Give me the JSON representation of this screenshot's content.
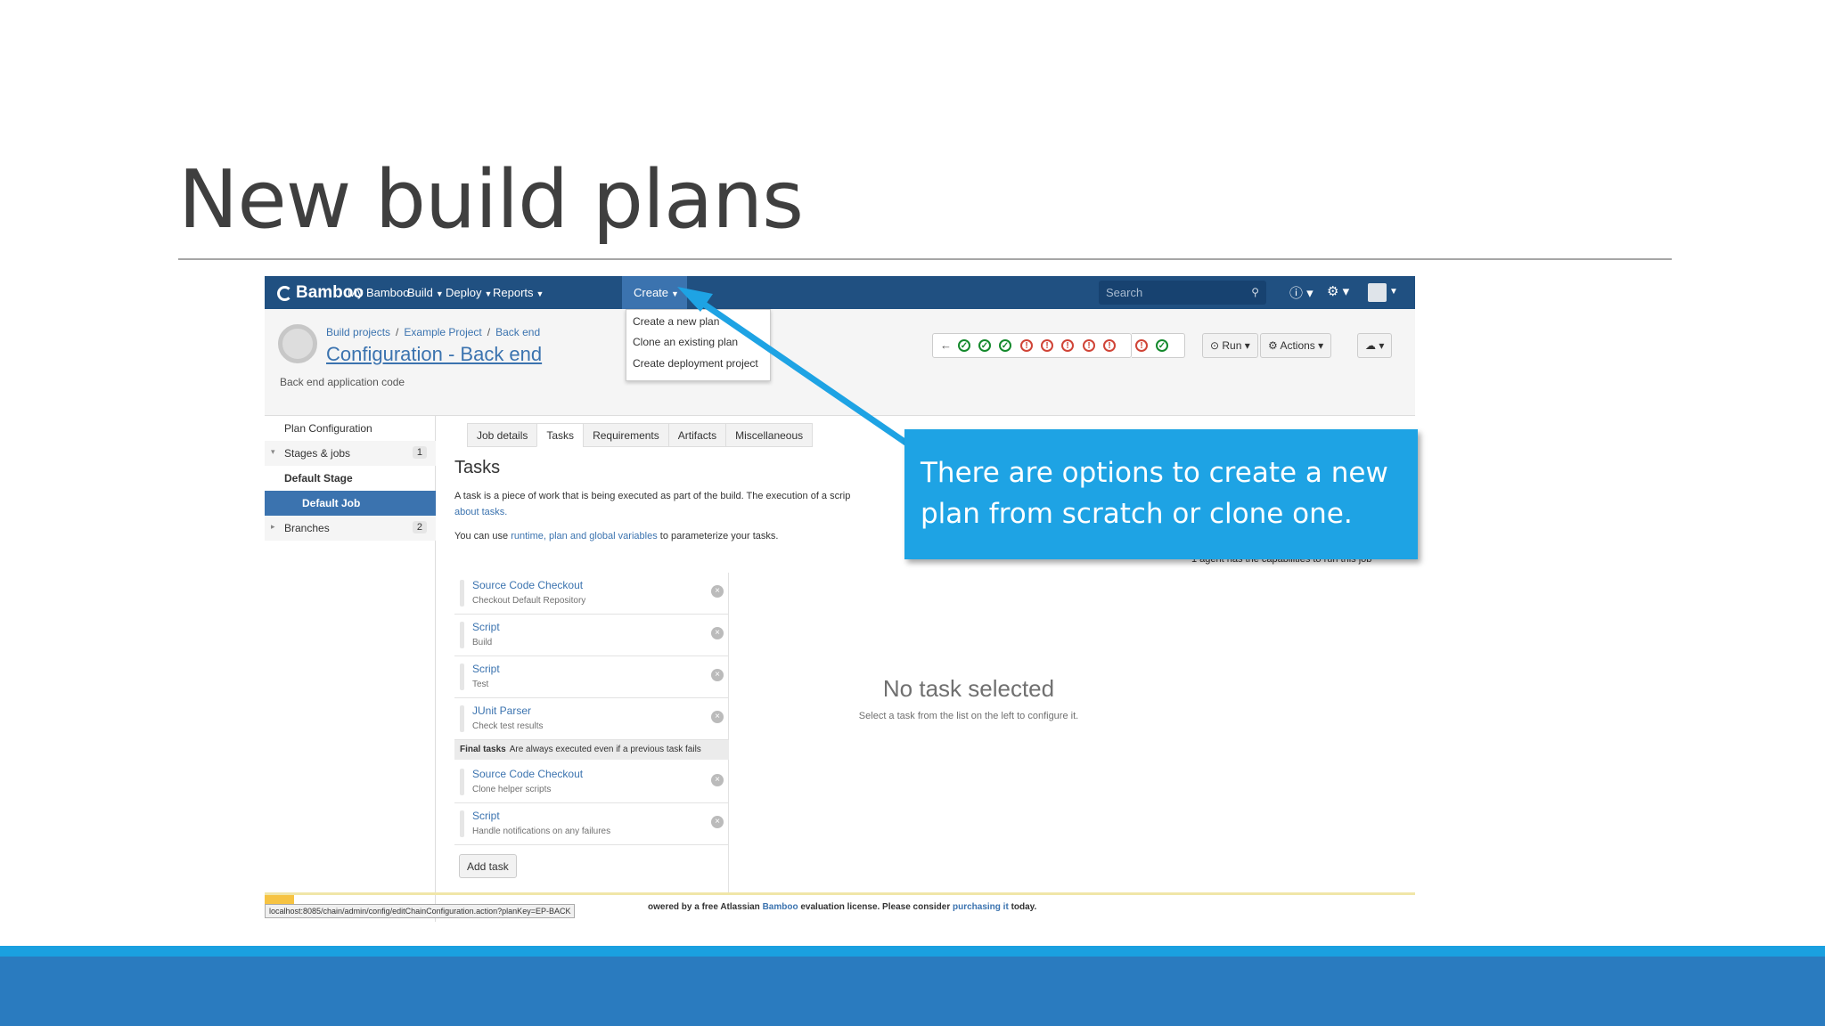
{
  "slide": {
    "title": "New build plans",
    "callout": "There are options to create a new plan from scratch or clone one."
  },
  "colors": {
    "bamboo_header": "#205081",
    "link": "#3b73af",
    "callout": "#1ea3e4",
    "band": "#2a7bbf"
  },
  "app": {
    "logo": "Bamboo",
    "nav": [
      "My Bamboo",
      "Build",
      "Deploy",
      "Reports",
      "Create"
    ],
    "search_placeholder": "Search",
    "create_menu": [
      "Create a new plan",
      "Clone an existing plan",
      "Create deployment project"
    ]
  },
  "plan": {
    "breadcrumbs": [
      "Build projects",
      "Example Project",
      "Back end"
    ],
    "title": "Configuration - Back end",
    "description": "Back end application code",
    "status_icons": [
      "pass",
      "pass",
      "pass",
      "fail",
      "fail",
      "fail",
      "fail",
      "fail",
      "fail",
      "pass"
    ],
    "run_label": "Run",
    "actions_label": "Actions"
  },
  "sidebar": {
    "items": [
      {
        "label": "Plan Configuration"
      },
      {
        "label": "Stages & jobs",
        "count": "1"
      },
      {
        "label": "Default Stage"
      },
      {
        "label": "Default Job"
      },
      {
        "label": "Branches",
        "count": "2"
      }
    ]
  },
  "tabs": [
    "Job details",
    "Tasks",
    "Requirements",
    "Artifacts",
    "Miscellaneous"
  ],
  "tasks_panel": {
    "heading": "Tasks",
    "desc_line1": "A task is a piece of work that is being executed as part of the build. The execution of a scrip",
    "desc_line1_link": "about tasks.",
    "desc_line2_pre": "You can use ",
    "desc_line2_link": "runtime, plan and global variables",
    "desc_line2_post": " to parameterize your tasks.",
    "agents_note": "1 agent has the capabilities to run this job",
    "tasks": [
      {
        "name": "Source Code Checkout",
        "sub": "Checkout Default Repository"
      },
      {
        "name": "Script",
        "sub": "Build"
      },
      {
        "name": "Script",
        "sub": "Test"
      },
      {
        "name": "JUnit Parser",
        "sub": "Check test results"
      }
    ],
    "final_label": "Final tasks",
    "final_note": "Are always executed even if a previous task fails",
    "final_tasks": [
      {
        "name": "Source Code Checkout",
        "sub": "Clone helper scripts"
      },
      {
        "name": "Script",
        "sub": "Handle notifications on any failures"
      }
    ],
    "add_task": "Add task",
    "empty_title": "No task selected",
    "empty_sub": "Select a task from the list on the left to configure it."
  },
  "footer": {
    "text_pre": "owered by a free Atlassian ",
    "text_link": "Bamboo",
    "text_mid": " evaluation license. Please consider ",
    "text_link2": "purchasing it",
    "text_post": " today.",
    "status_url": "localhost:8085/chain/admin/config/editChainConfiguration.action?planKey=EP-BACK"
  }
}
